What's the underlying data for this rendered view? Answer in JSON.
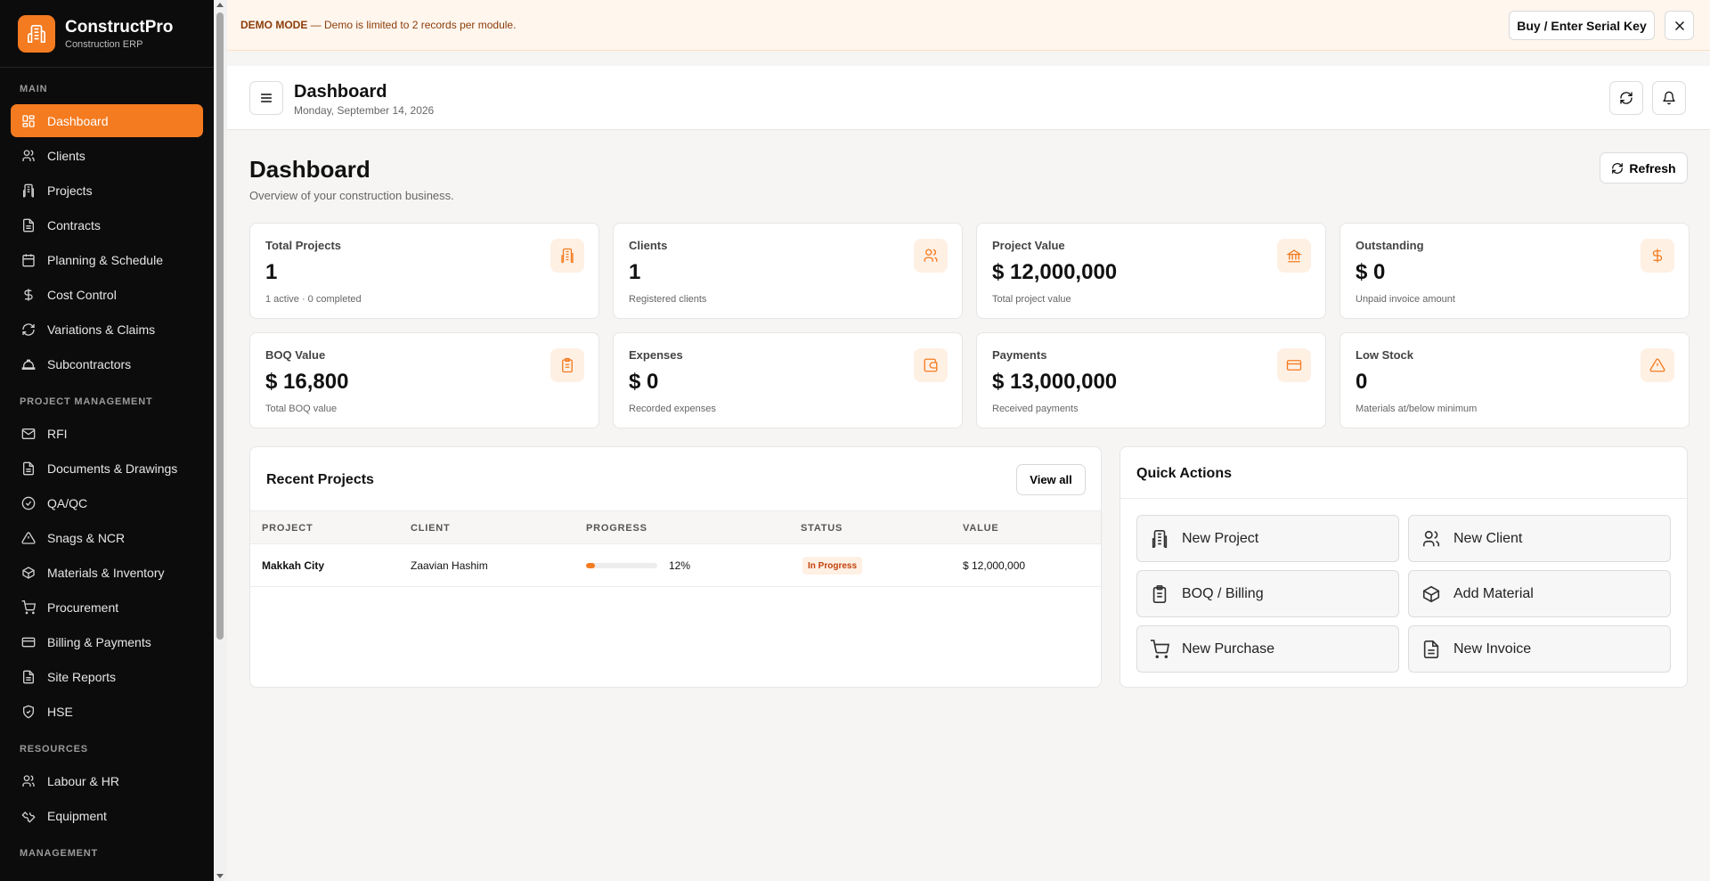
{
  "brand": {
    "name": "ConstructPro",
    "subtitle": "Construction ERP"
  },
  "sidebar": {
    "sections": [
      {
        "label": "MAIN"
      },
      {
        "label": "PROJECT MANAGEMENT"
      },
      {
        "label": "RESOURCES"
      },
      {
        "label": "MANAGEMENT"
      }
    ],
    "items": [
      {
        "label": "Dashboard",
        "icon": "dashboard-icon",
        "active": true
      },
      {
        "label": "Clients",
        "icon": "users-icon"
      },
      {
        "label": "Projects",
        "icon": "building-icon"
      },
      {
        "label": "Contracts",
        "icon": "document-icon"
      },
      {
        "label": "Planning & Schedule",
        "icon": "calendar-icon"
      },
      {
        "label": "Cost Control",
        "icon": "dollar-icon"
      },
      {
        "label": "Variations & Claims",
        "icon": "refresh-icon"
      },
      {
        "label": "Subcontractors",
        "icon": "hardhat-icon"
      },
      {
        "label": "RFI",
        "icon": "mail-icon"
      },
      {
        "label": "Documents & Drawings",
        "icon": "document-icon"
      },
      {
        "label": "QA/QC",
        "icon": "check-circle-icon"
      },
      {
        "label": "Snags & NCR",
        "icon": "warning-icon"
      },
      {
        "label": "Materials & Inventory",
        "icon": "box-icon"
      },
      {
        "label": "Procurement",
        "icon": "cart-icon"
      },
      {
        "label": "Billing & Payments",
        "icon": "credit-card-icon"
      },
      {
        "label": "Site Reports",
        "icon": "document-icon"
      },
      {
        "label": "HSE",
        "icon": "shield-icon"
      },
      {
        "label": "Labour & HR",
        "icon": "users-icon"
      },
      {
        "label": "Equipment",
        "icon": "wrench-icon"
      }
    ]
  },
  "banner": {
    "mode": "DEMO MODE",
    "message": " — Demo is limited to 2 records per module.",
    "serial_button": "Buy / Enter Serial Key",
    "close_icon": "close-icon"
  },
  "topbar": {
    "title": "Dashboard",
    "date": "Monday, September 14, 2026"
  },
  "page": {
    "title": "Dashboard",
    "subtitle": "Overview of your construction business.",
    "refresh_label": "Refresh"
  },
  "stats": [
    {
      "label": "Total Projects",
      "value": "1",
      "note": "1 active · 0 completed",
      "icon": "building-icon"
    },
    {
      "label": "Clients",
      "value": "1",
      "note": "Registered clients",
      "icon": "users-icon"
    },
    {
      "label": "Project Value",
      "value": "$ 12,000,000",
      "note": "Total project value",
      "icon": "bank-icon"
    },
    {
      "label": "Outstanding",
      "value": "$ 0",
      "note": "Unpaid invoice amount",
      "icon": "dollar-icon"
    },
    {
      "label": "BOQ Value",
      "value": "$ 16,800",
      "note": "Total BOQ value",
      "icon": "clipboard-icon"
    },
    {
      "label": "Expenses",
      "value": "$ 0",
      "note": "Recorded expenses",
      "icon": "wallet-icon"
    },
    {
      "label": "Payments",
      "value": "$ 13,000,000",
      "note": "Received payments",
      "icon": "credit-card-icon"
    },
    {
      "label": "Low Stock",
      "value": "0",
      "note": "Materials at/below minimum",
      "icon": "warning-icon"
    }
  ],
  "recent_projects": {
    "title": "Recent Projects",
    "view_all": "View all",
    "columns": [
      "PROJECT",
      "CLIENT",
      "PROGRESS",
      "STATUS",
      "VALUE"
    ],
    "rows": [
      {
        "project": "Makkah City",
        "client": "Zaavian Hashim",
        "progress": 12,
        "progress_label": "12%",
        "status": "In Progress",
        "value": "$ 12,000,000"
      }
    ]
  },
  "quick_actions": {
    "title": "Quick Actions",
    "buttons": [
      {
        "label": "New Project",
        "icon": "building-icon"
      },
      {
        "label": "New Client",
        "icon": "users-icon"
      },
      {
        "label": "BOQ / Billing",
        "icon": "clipboard-icon"
      },
      {
        "label": "Add Material",
        "icon": "box-icon"
      },
      {
        "label": "New Purchase",
        "icon": "cart-icon"
      },
      {
        "label": "New Invoice",
        "icon": "document-icon"
      }
    ]
  },
  "colors": {
    "accent": "#f47b20",
    "sidebar_bg": "#0c0c0c",
    "page_bg": "#f6f5f3"
  }
}
